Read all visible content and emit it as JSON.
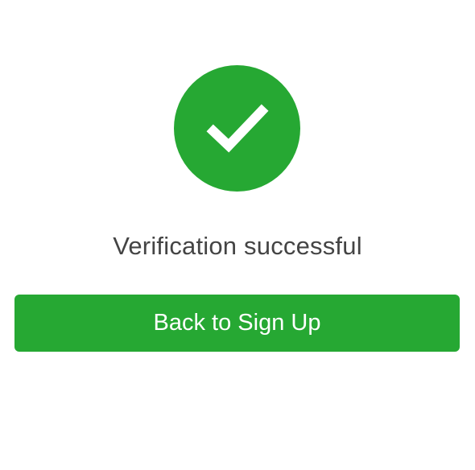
{
  "status": {
    "icon": "checkmark-circle-icon",
    "message": "Verification successful"
  },
  "actions": {
    "back_label": "Back to Sign Up"
  },
  "colors": {
    "accent": "#26a833",
    "text": "#444444",
    "background": "#ffffff"
  }
}
